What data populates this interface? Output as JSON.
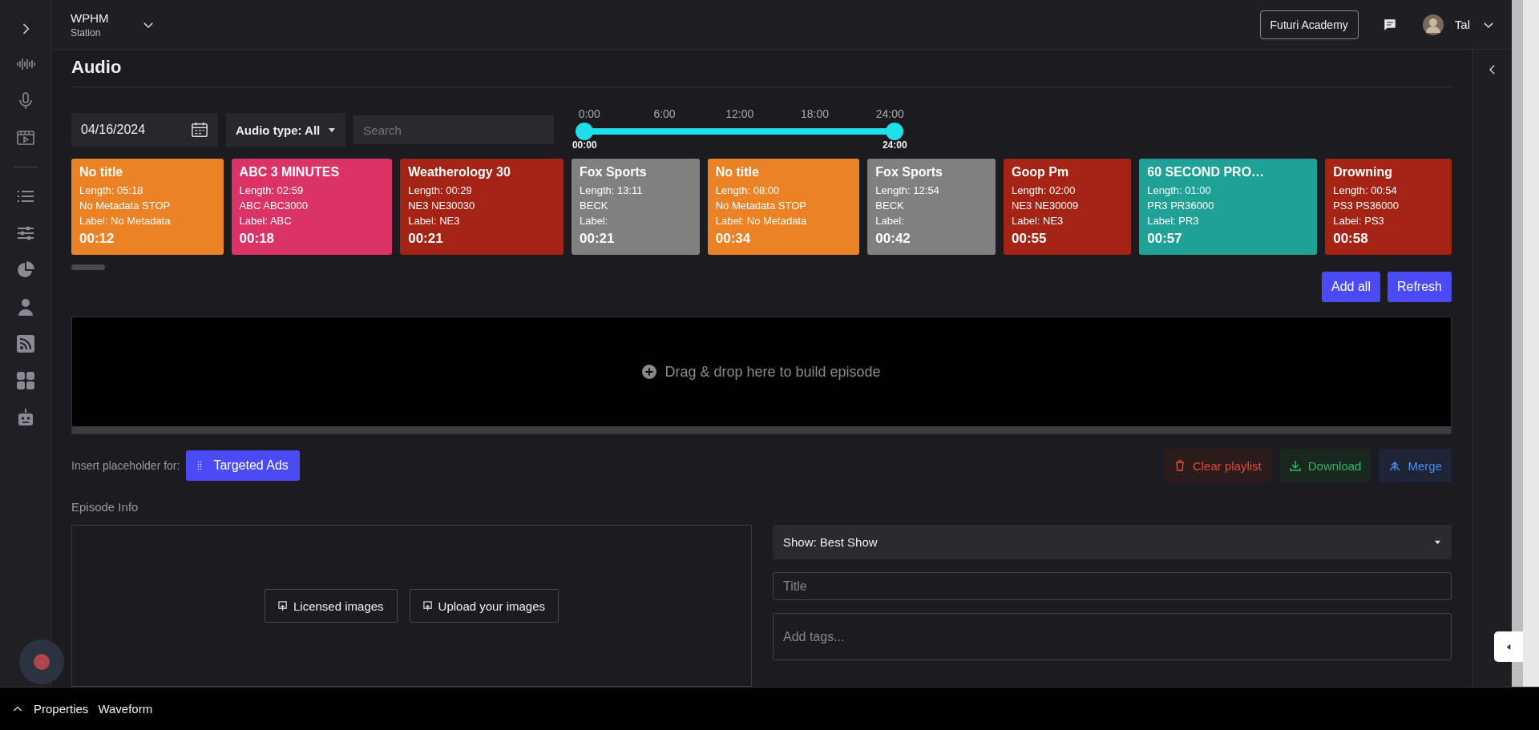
{
  "station": {
    "name": "WPHM",
    "subtitle": "Station"
  },
  "header": {
    "academy_button": "Futuri Academy",
    "user": "Tal"
  },
  "page_title": "Audio",
  "filters": {
    "date": "04/16/2024",
    "audio_type": "Audio type: All",
    "search": {
      "placeholder": "Search"
    }
  },
  "time_range": {
    "ticks": [
      "0:00",
      "6:00",
      "12:00",
      "18:00",
      "24:00"
    ],
    "thumbs": [
      {
        "level": 0,
        "reading": "00:00"
      },
      {
        "level": 1,
        "reading": "24:00"
      }
    ]
  },
  "clips": [
    {
      "title": "No title",
      "length": "Length: 05:18",
      "meta": "No Metadata STOP",
      "label": "Label: No Metadata",
      "time": "00:12",
      "color": "#eb8226"
    },
    {
      "title": "ABC 3 MINUTES",
      "length": "Length: 02:59",
      "meta": "ABC ABC3000",
      "label": "Label: ABC",
      "time": "00:18",
      "color": "#dc3366"
    },
    {
      "title": "Weatherology 30",
      "length": "Length: 00:29",
      "meta": "NE3 NE30030",
      "label": "Label: NE3",
      "time": "00:21",
      "color": "#a52314"
    },
    {
      "title": "Fox Sports",
      "length": "Length: 13:11",
      "meta": "BECK",
      "label": "Label:",
      "time": "00:21",
      "color": "#808080"
    },
    {
      "title": "No title",
      "length": "Length: 08:00",
      "meta": "No Metadata STOP",
      "label": "Label: No Metadata",
      "time": "00:34",
      "color": "#eb8226"
    },
    {
      "title": "Fox Sports",
      "length": "Length: 12:54",
      "meta": "BECK",
      "label": "Label:",
      "time": "00:42",
      "color": "#808080"
    },
    {
      "title": "Goop Pm",
      "length": "Length: 02:00",
      "meta": "NE3 NE30009",
      "label": "Label: NE3",
      "time": "00:55",
      "color": "#a52314"
    },
    {
      "title": "60 SECOND PRO…",
      "length": "Length: 01:00",
      "meta": "PR3 PR36000",
      "label": "Label: PR3",
      "time": "00:57",
      "color": "#1fa196"
    },
    {
      "title": "Drowning",
      "length": "Length: 00:54",
      "meta": "PS3 PS36000",
      "label": "Label: PS3",
      "time": "00:58",
      "color": "#a52314"
    }
  ],
  "actions": [
    "Add all",
    "Refresh"
  ],
  "drop_zone": "Drag & drop here to build episode",
  "placeholder_row": {
    "label": "Insert placeholder for:",
    "button": "Targeted Ads"
  },
  "playlist_buttons": [
    {
      "label": "Clear playlist",
      "kind": "clear"
    },
    {
      "label": "Download",
      "kind": "download"
    },
    {
      "label": "Merge",
      "kind": "merge"
    }
  ],
  "episode_info": {
    "heading": "Episode Info",
    "image_buttons": [
      "Licensed images",
      "Upload your images"
    ],
    "show_select": "Show: Best Show",
    "title": {
      "placeholder": "Title"
    },
    "tags": {
      "placeholder": "Add tags..."
    }
  },
  "bottom_tabs": [
    "Properties",
    "Waveform"
  ]
}
